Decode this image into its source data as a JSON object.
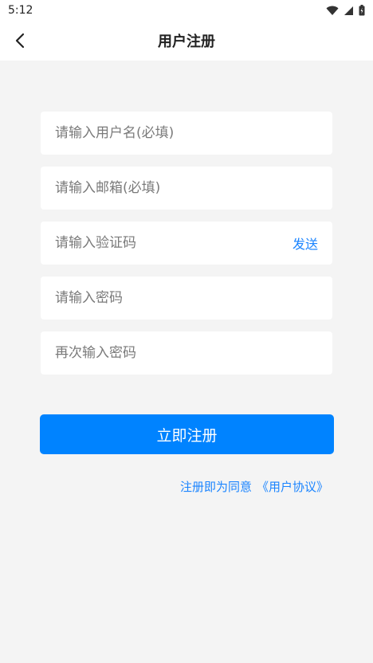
{
  "status": {
    "time": "5:12"
  },
  "header": {
    "title": "用户注册"
  },
  "form": {
    "username_placeholder": "请输入用户名(必填)",
    "email_placeholder": "请输入邮箱(必填)",
    "code_placeholder": "请输入验证码",
    "send_label": "发送",
    "password_placeholder": "请输入密码",
    "confirm_placeholder": "再次输入密码"
  },
  "actions": {
    "submit_label": "立即注册"
  },
  "agreement": {
    "prefix": "注册即为同意",
    "link_label": "《用户协议》"
  },
  "colors": {
    "accent": "#0083ff",
    "link": "#1a84ff",
    "background": "#f4f4f4"
  },
  "icons": [
    "wifi-icon",
    "signal-icon",
    "battery-icon",
    "back-arrow-icon"
  ]
}
